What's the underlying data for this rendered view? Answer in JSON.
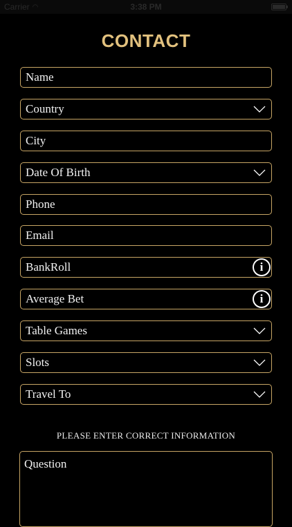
{
  "status_bar": {
    "carrier": "Carrier",
    "time": "3:38 PM"
  },
  "title": "CONTACT",
  "form": {
    "name": "Name",
    "country": "Country",
    "city": "City",
    "date_of_birth": "Date Of Birth",
    "phone": "Phone",
    "email": "Email",
    "bankroll": "BankRoll",
    "average_bet": "Average Bet",
    "table_games": "Table Games",
    "slots": "Slots",
    "travel_to": "Travel To"
  },
  "notice": "PLEASE ENTER CORRECT INFORMATION",
  "question_label": "Question",
  "icons": {
    "dropdown": "chevron-down-icon",
    "info": "info-icon"
  },
  "colors": {
    "accent": "#e2c17e",
    "border": "#c9a766",
    "background": "#000000"
  }
}
